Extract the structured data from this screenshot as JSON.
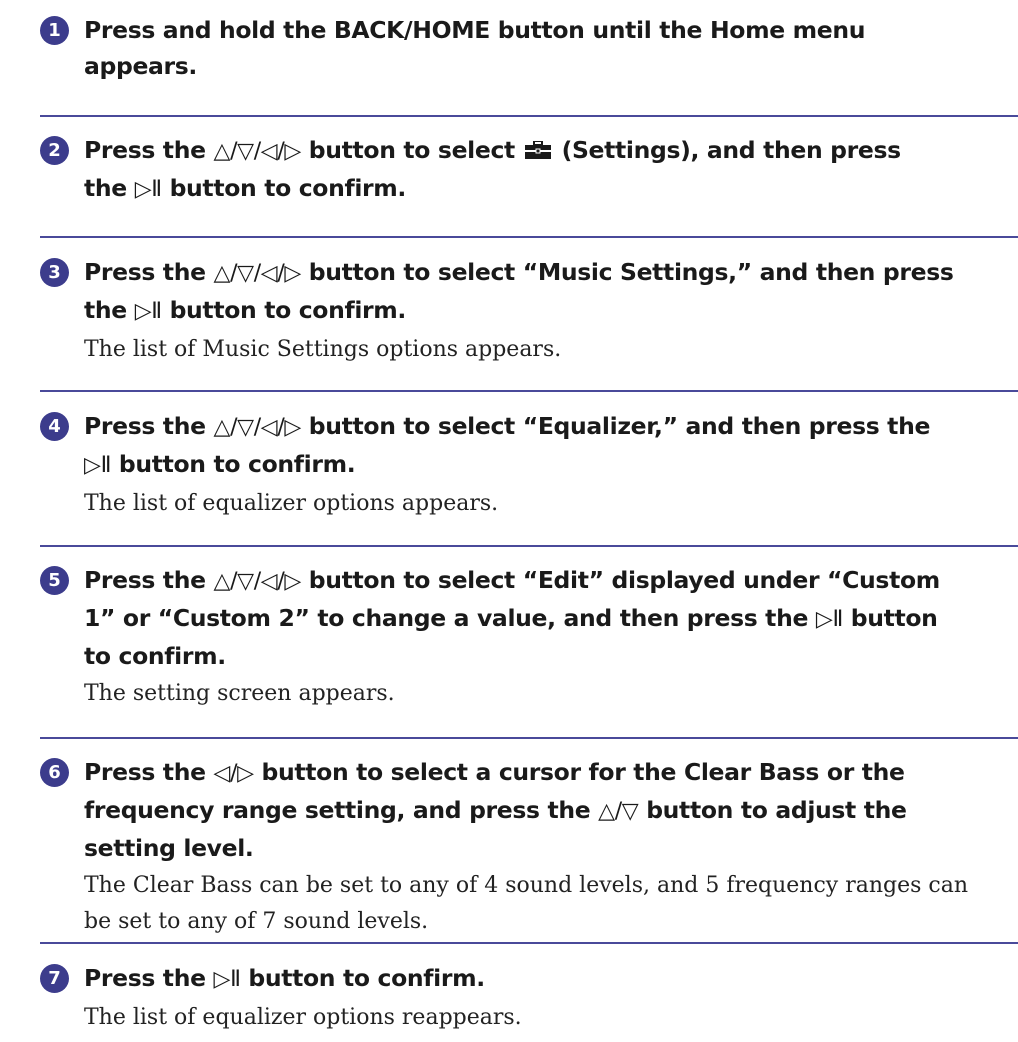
{
  "steps": [
    {
      "number": "1",
      "parts": [
        {
          "t": "text",
          "v": "Press and hold the BACK/HOME button until the Home menu "
        },
        {
          "t": "br"
        },
        {
          "t": "text",
          "v": "appears."
        }
      ],
      "body": ""
    },
    {
      "number": "2",
      "parts": [
        {
          "t": "text",
          "v": "Press the "
        },
        {
          "t": "glyph",
          "v": "△/▽/◁/▷",
          "name": "direction-buttons-icon"
        },
        {
          "t": "text",
          "v": " button to select "
        },
        {
          "t": "icon",
          "name": "settings-toolbox-icon"
        },
        {
          "t": "text",
          "v": " (Settings), and then press "
        },
        {
          "t": "br"
        },
        {
          "t": "text",
          "v": "the "
        },
        {
          "t": "glyph",
          "v": "▷Ⅱ",
          "name": "play-pause-icon"
        },
        {
          "t": "text",
          "v": " button to confirm."
        }
      ],
      "body": ""
    },
    {
      "number": "3",
      "parts": [
        {
          "t": "text",
          "v": "Press the "
        },
        {
          "t": "glyph",
          "v": "△/▽/◁/▷",
          "name": "direction-buttons-icon"
        },
        {
          "t": "text",
          "v": " button to select “Music Settings,” and then press "
        },
        {
          "t": "br"
        },
        {
          "t": "text",
          "v": "the "
        },
        {
          "t": "glyph",
          "v": "▷Ⅱ",
          "name": "play-pause-icon"
        },
        {
          "t": "text",
          "v": " button to confirm."
        }
      ],
      "body": "The list of Music Settings options appears."
    },
    {
      "number": "4",
      "parts": [
        {
          "t": "text",
          "v": "Press the "
        },
        {
          "t": "glyph",
          "v": "△/▽/◁/▷",
          "name": "direction-buttons-icon"
        },
        {
          "t": "text",
          "v": " button to select “Equalizer,” and then press the "
        },
        {
          "t": "br"
        },
        {
          "t": "glyph",
          "v": "▷Ⅱ",
          "name": "play-pause-icon"
        },
        {
          "t": "text",
          "v": " button to confirm."
        }
      ],
      "body": "The list of equalizer options appears."
    },
    {
      "number": "5",
      "parts": [
        {
          "t": "text",
          "v": "Press the "
        },
        {
          "t": "glyph",
          "v": "△/▽/◁/▷",
          "name": "direction-buttons-icon"
        },
        {
          "t": "text",
          "v": " button to select “Edit” displayed under “Custom "
        },
        {
          "t": "br"
        },
        {
          "t": "text",
          "v": "1” or “Custom 2” to change a value, and then press the "
        },
        {
          "t": "glyph",
          "v": "▷Ⅱ",
          "name": "play-pause-icon"
        },
        {
          "t": "text",
          "v": " button "
        },
        {
          "t": "br"
        },
        {
          "t": "text",
          "v": "to confirm."
        }
      ],
      "body": "The setting screen appears."
    },
    {
      "number": "6",
      "parts": [
        {
          "t": "text",
          "v": "Press the "
        },
        {
          "t": "glyph",
          "v": "◁/▷",
          "name": "left-right-buttons-icon"
        },
        {
          "t": "text",
          "v": " button to select a cursor for the Clear Bass or the "
        },
        {
          "t": "br"
        },
        {
          "t": "text",
          "v": "frequency range setting, and press the "
        },
        {
          "t": "glyph",
          "v": "△/▽",
          "name": "up-down-buttons-icon"
        },
        {
          "t": "text",
          "v": " button to adjust the "
        },
        {
          "t": "br"
        },
        {
          "t": "text",
          "v": "setting level."
        }
      ],
      "body": "The Clear Bass can be set to any of 4 sound levels, and 5 frequency ranges can be set to any of 7 sound levels."
    },
    {
      "number": "7",
      "parts": [
        {
          "t": "text",
          "v": "Press the "
        },
        {
          "t": "glyph",
          "v": "▷Ⅱ",
          "name": "play-pause-icon"
        },
        {
          "t": "text",
          "v": " button to confirm."
        }
      ],
      "body": "The list of equalizer options reappears."
    }
  ]
}
